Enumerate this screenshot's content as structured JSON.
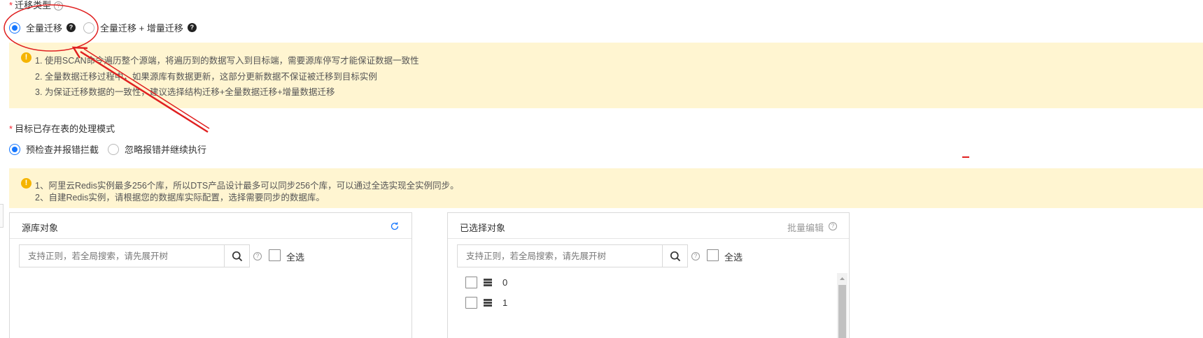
{
  "migration_type": {
    "label": "迁移类型",
    "options": [
      {
        "label": "全量迁移",
        "checked": true
      },
      {
        "label": "全量迁移 + 增量迁移",
        "checked": false
      }
    ]
  },
  "migration_notice": {
    "lines": [
      "1. 使用SCAN命令遍历整个源端，将遍历到的数据写入到目标端，需要源库停写才能保证数据一致性",
      "2. 全量数据迁移过程中，如果源库有数据更新，这部分更新数据不保证被迁移到目标实例",
      "3. 为保证迁移数据的一致性，建议选择结构迁移+全量数据迁移+增量数据迁移"
    ]
  },
  "existing_table_mode": {
    "label": "目标已存在表的处理模式",
    "options": [
      {
        "label": "预检查并报错拦截",
        "checked": true
      },
      {
        "label": "忽略报错并继续执行",
        "checked": false
      }
    ]
  },
  "redis_notice": {
    "lines": [
      "1、阿里云Redis实例最多256个库，所以DTS产品设计最多可以同步256个库，可以通过全选实现全实例同步。",
      "2、自建Redis实例，请根据您的数据库实际配置，选择需要同步的数据库。"
    ]
  },
  "source_panel": {
    "title": "源库对象",
    "search_placeholder": "支持正则，若全局搜索，请先展开树",
    "select_all": "全选"
  },
  "selected_panel": {
    "title": "已选择对象",
    "batch_edit": "批量编辑",
    "search_placeholder": "支持正则，若全局搜索，请先展开树",
    "select_all": "全选",
    "items": [
      "0",
      "1"
    ]
  },
  "colors": {
    "accent": "#1677ff",
    "notice_bg": "#fff5d1",
    "warning": "#f5b400",
    "annotation_red": "#e02020"
  }
}
